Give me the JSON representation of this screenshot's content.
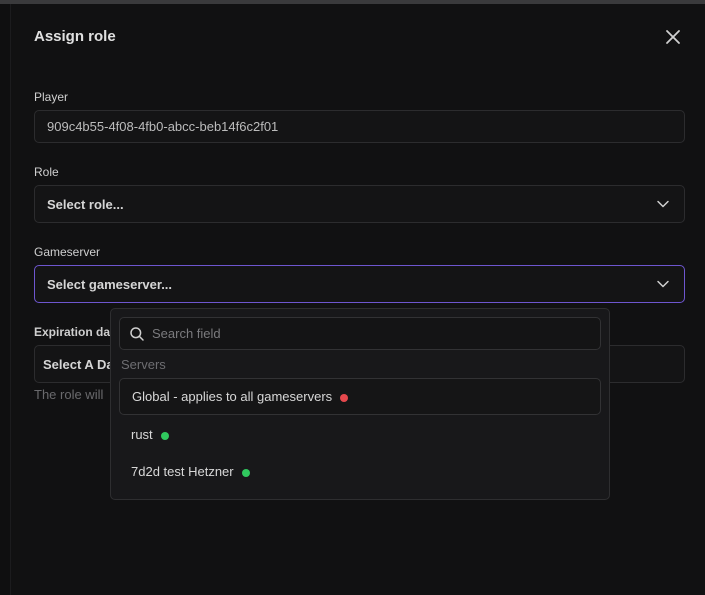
{
  "modal": {
    "title": "Assign role",
    "fields": {
      "player": {
        "label": "Player",
        "value": "909c4b55-4f08-4fb0-abcc-beb14f6c2f01"
      },
      "role": {
        "label": "Role",
        "placeholder": "Select role..."
      },
      "gameserver": {
        "label": "Gameserver",
        "placeholder": "Select gameserver..."
      },
      "expiration": {
        "label": "Expiration dat",
        "placeholder": "Select A Da",
        "helper": "The role will"
      }
    },
    "dropdown": {
      "search_placeholder": "Search field",
      "group_label": "Servers",
      "options": [
        {
          "label": "Global - applies to all gameservers",
          "status_color": "#e5484d"
        },
        {
          "label": "rust",
          "status_color": "#30c85e"
        },
        {
          "label": "7d2d test Hetzner",
          "status_color": "#30c85e"
        }
      ]
    }
  },
  "colors": {
    "accent": "#6e56cf",
    "status_offline": "#e5484d",
    "status_online": "#30c85e"
  }
}
